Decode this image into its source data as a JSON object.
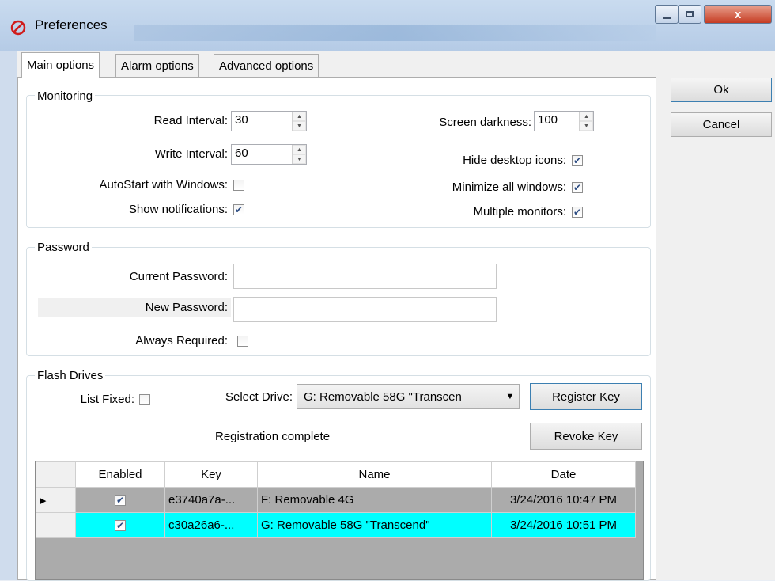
{
  "window": {
    "title": "Preferences",
    "close_label": "x"
  },
  "tabs": [
    "Main options",
    "Alarm options",
    "Advanced options"
  ],
  "buttons": {
    "ok": "Ok",
    "cancel": "Cancel"
  },
  "monitoring": {
    "legend": "Monitoring",
    "read_interval_label": "Read Interval:",
    "read_interval_value": "30",
    "write_interval_label": "Write Interval:",
    "write_interval_value": "60",
    "autostart_label": "AutoStart with Windows:",
    "autostart_checked": false,
    "show_notifications_label": "Show notifications:",
    "show_notifications_checked": true,
    "screen_darkness_label": "Screen darkness:",
    "screen_darkness_value": "100",
    "hide_desktop_icons_label": "Hide desktop icons:",
    "hide_desktop_icons_checked": true,
    "minimize_all_windows_label": "Minimize all windows:",
    "minimize_all_windows_checked": true,
    "multiple_monitors_label": "Multiple monitors:",
    "multiple_monitors_checked": true
  },
  "password": {
    "legend": "Password",
    "current_label": "Current Password:",
    "current_value": "",
    "new_label": "New Password:",
    "new_value": "",
    "always_required_label": "Always Required:",
    "always_required_checked": false
  },
  "flash_drives": {
    "legend": "Flash Drives",
    "list_fixed_label": "List Fixed:",
    "list_fixed_checked": false,
    "select_drive_label": "Select Drive:",
    "select_drive_value": "G: Removable 58G \"Transcen",
    "register_key_label": "Register Key",
    "revoke_key_label": "Revoke Key",
    "status_text": "Registration complete"
  },
  "grid": {
    "columns": [
      "Enabled",
      "Key",
      "Name",
      "Date"
    ],
    "rows": [
      {
        "enabled": true,
        "key": "e3740a7a-...",
        "name": "F: Removable 4G",
        "date": "3/24/2016 10:47 PM",
        "current": true,
        "selected": false
      },
      {
        "enabled": true,
        "key": "c30a26a6-...",
        "name": "G: Removable 58G \"Transcend\"",
        "date": "3/24/2016 10:51 PM",
        "current": false,
        "selected": true
      }
    ]
  },
  "colors": {
    "selection": "#00ffff",
    "title_bar": "#c9dbef",
    "close_button": "#c63c23"
  }
}
